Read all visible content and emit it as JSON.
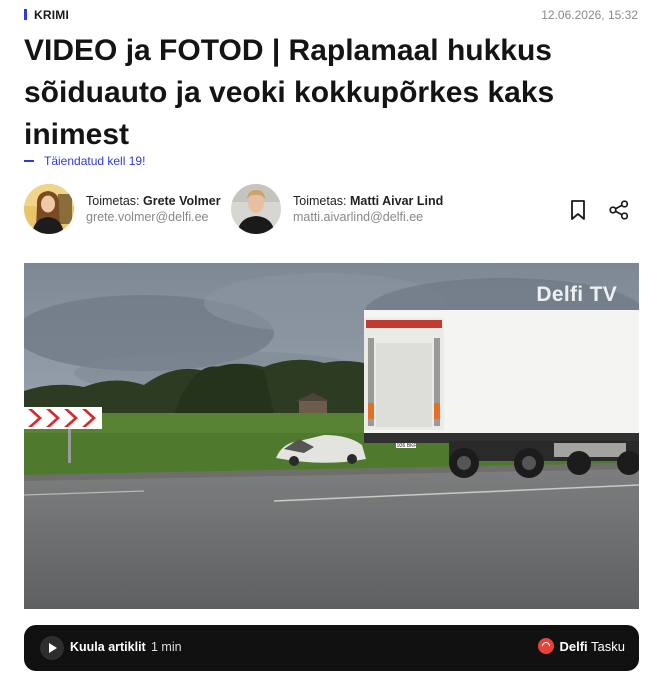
{
  "header": {
    "category": "KRIMI",
    "datetime": "12.06.2026, 15:32",
    "accent_color": "#2f3bd6"
  },
  "article": {
    "headline": "VIDEO ja FOTOD | Raplamaal hukkus sõiduauto ja veoki kokkupõrkes kaks inimest",
    "updated": "Täiendatud kell 19!"
  },
  "authors": [
    {
      "role": "Toimetas:",
      "name": "Grete Volmer",
      "email": "grete.volmer@delfi.ee"
    },
    {
      "role": "Toimetas:",
      "name": "Matti Aivar Lind",
      "email": "matti.aivarlind@delfi.ee"
    }
  ],
  "actions": {
    "bookmark_icon": "bookmark-icon",
    "share_icon": "share-icon"
  },
  "media": {
    "watermark": "Delfi TV",
    "truck_plate": "936 BKF"
  },
  "audio_player": {
    "listen_label": "Kuula artiklit",
    "duration": "1 min",
    "brand_bold": "Delfi",
    "brand_regular": "Tasku",
    "brand_color": "#e8433a"
  }
}
